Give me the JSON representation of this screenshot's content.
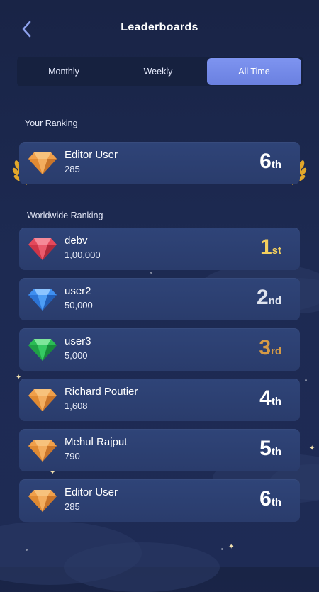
{
  "header": {
    "title": "Leaderboards",
    "back_icon": "chevron-left-icon"
  },
  "tabs": [
    {
      "label": "Monthly",
      "active": false
    },
    {
      "label": "Weekly",
      "active": false
    },
    {
      "label": "All Time",
      "active": true
    }
  ],
  "your_ranking": {
    "label": "Your Ranking",
    "entry": {
      "name": "Editor User",
      "score": "285",
      "rank_num": "6",
      "rank_suffix": "th",
      "gem": "orange-diamond-icon",
      "rank_color": "#ffffff"
    }
  },
  "worldwide": {
    "label": "Worldwide Ranking",
    "entries": [
      {
        "name": "debv",
        "score": "1,00,000",
        "rank_num": "1",
        "rank_suffix": "st",
        "gem": "red-diamond-icon",
        "rank_color": "#f3cf5e"
      },
      {
        "name": "user2",
        "score": "50,000",
        "rank_num": "2",
        "rank_suffix": "nd",
        "gem": "blue-diamond-icon",
        "rank_color": "#dfe3ee"
      },
      {
        "name": "user3",
        "score": "5,000",
        "rank_num": "3",
        "rank_suffix": "rd",
        "gem": "green-diamond-icon",
        "rank_color": "#d69a45"
      },
      {
        "name": "Richard Poutier",
        "score": "1,608",
        "rank_num": "4",
        "rank_suffix": "th",
        "gem": "orange-diamond-icon",
        "rank_color": "#ffffff"
      },
      {
        "name": "Mehul Rajput",
        "score": "790",
        "rank_num": "5",
        "rank_suffix": "th",
        "gem": "orange-diamond-icon",
        "rank_color": "#ffffff"
      },
      {
        "name": "Editor User",
        "score": "285",
        "rank_num": "6",
        "rank_suffix": "th",
        "gem": "orange-diamond-icon",
        "rank_color": "#ffffff"
      }
    ]
  },
  "colors": {
    "accent": "#7088e8",
    "card": "#2c3f70",
    "background": "#1b2749",
    "gold": "#f3cf5e",
    "laurel": "#e2a72a"
  }
}
